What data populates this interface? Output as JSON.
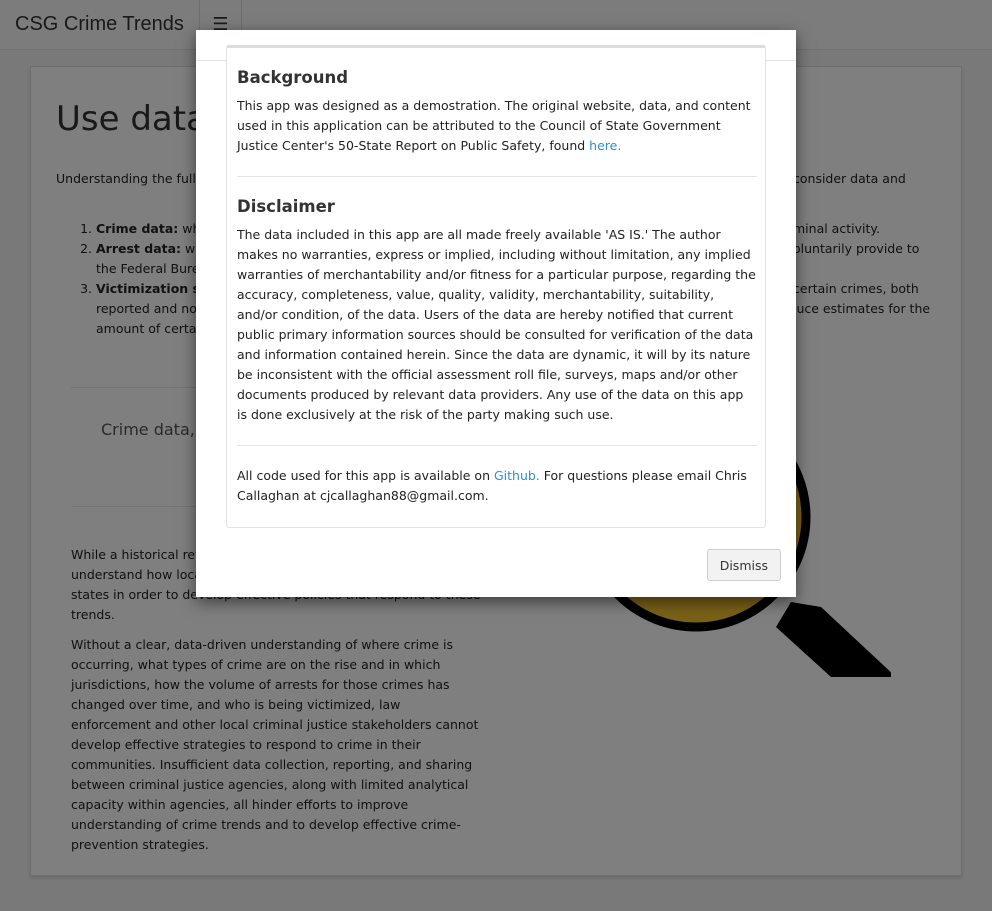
{
  "navbar": {
    "brand": "CSG Crime Trends",
    "toggle_icon": "hamburger-menu-icon"
  },
  "page": {
    "title_visible": "Use data t",
    "intro_left_visible": "Understanding the full e trends across three mea",
    "intro_right_visible": "consider data and",
    "list_items": [
      {
        "term": "Crime data:",
        "rest_visible": "whic"
      },
      {
        "term": "Arrest data:",
        "rest_visible": "whic"
      },
      {
        "term": "Victimization sur",
        "rest_visible": ""
      }
    ],
    "list_fragments": {
      "arrest_line2": "the Federal Burea",
      "victim_line2": "reported and not",
      "victim_line3": "amount of certai",
      "right_line1": "minal activity.",
      "right_line2": "oluntarily provide to",
      "right_line3": "certain crimes, both",
      "right_line4": "roduce estimates for the"
    },
    "quote_visible": "Crime data, a surveys are a criminal activ",
    "paragraph1_visible": "While a historical revi trends at the national policymakers must understand how local dynamics are influencing trends in their states in order to develop effective policies that respond to these trends.",
    "paragraph2": "Without a clear, data-driven understanding of where crime is occurring, what types of crime are on the rise and in which jurisdictions, how the volume of arrests for those crimes has changed over time, and who is being victimized, law enforcement and other local criminal justice stakeholders cannot develop effective strategies to respond to crime in their communities. Insufficient data collection, reporting, and sharing between criminal justice agencies, along with limited analytical capacity within agencies, all hinder efforts to improve understanding of crime trends and to develop effective crime-prevention strategies.",
    "illustration_icon": "magnifying-glass-icon"
  },
  "modal": {
    "background_heading": "Background",
    "background_text": "This app was designed as a demostration. The original website, data, and content used in this application can be attributed to the Council of State Government Justice Center's 50-State Report on Public Safety, found ",
    "background_link": "here.",
    "disclaimer_heading": "Disclaimer",
    "disclaimer_text": "The data included in this app are all made freely available 'AS IS.' The author makes no warranties, express or implied, including without limitation, any implied warranties of merchantability and/or fitness for a particular purpose, regarding the accuracy, completeness, value, quality, validity, merchantability, suitability, and/or condition, of the data. Users of the data are hereby notified that current public primary information sources should be consulted for verification of the data and information contained herein. Since the data are dynamic, it will by its nature be inconsistent with the official assessment roll file, surveys, maps and/or other documents produced by relevant data providers. Any use of the data on this app is done exclusively at the risk of the party making such use.",
    "code_text_before": "All code used for this app is available on ",
    "code_link": "Github.",
    "code_text_after": " For questions please email Chris Callaghan at cjcallaghan88@gmail.com.",
    "dismiss_label": "Dismiss"
  },
  "colors": {
    "link": "#2a8fd4",
    "backdrop": "rgba(0,0,0,0.5)"
  }
}
